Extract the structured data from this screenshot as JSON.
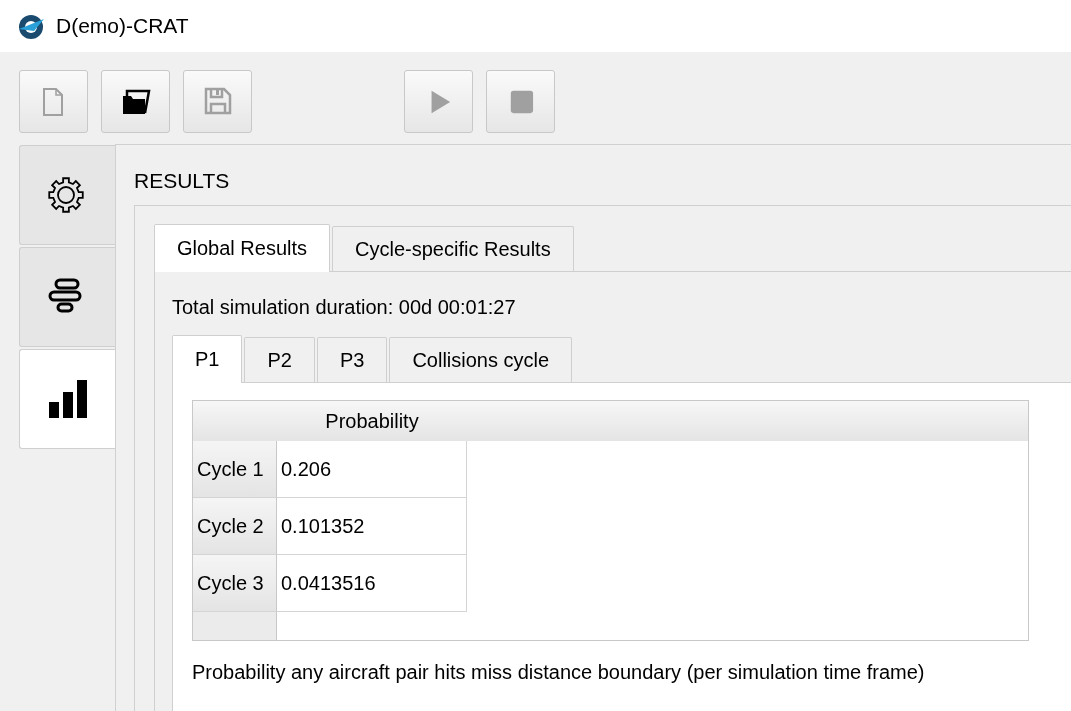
{
  "window": {
    "title": "D(emo)-CRAT"
  },
  "toolbar": [
    {
      "kind": "new",
      "disabled": true
    },
    {
      "kind": "open",
      "disabled": false
    },
    {
      "kind": "save",
      "disabled": true
    },
    {
      "kind": "play",
      "disabled": true
    },
    {
      "kind": "stop",
      "disabled": true
    }
  ],
  "side_tabs": [
    {
      "kind": "settings",
      "selected": false
    },
    {
      "kind": "timeline",
      "selected": false
    },
    {
      "kind": "results",
      "selected": true
    }
  ],
  "section_title": "RESULTS",
  "tabs": [
    {
      "label": "Global Results",
      "selected": true
    },
    {
      "label": "Cycle-specific Results",
      "selected": false
    }
  ],
  "duration": "Total simulation duration: 00d 00:01:27",
  "sub_tabs": [
    {
      "label": "P1",
      "selected": true
    },
    {
      "label": "P2",
      "selected": false
    },
    {
      "label": "P3",
      "selected": false
    },
    {
      "label": "Collisions cycle",
      "selected": false
    }
  ],
  "table": {
    "columns": [
      "Probability"
    ],
    "rows": [
      {
        "header": "Cycle 1",
        "value": "0.206"
      },
      {
        "header": "Cycle 2",
        "value": "0.101352"
      },
      {
        "header": "Cycle 3",
        "value": "0.0413516"
      }
    ]
  },
  "caption": "Probability any aircraft pair hits miss distance boundary (per simulation time frame)"
}
